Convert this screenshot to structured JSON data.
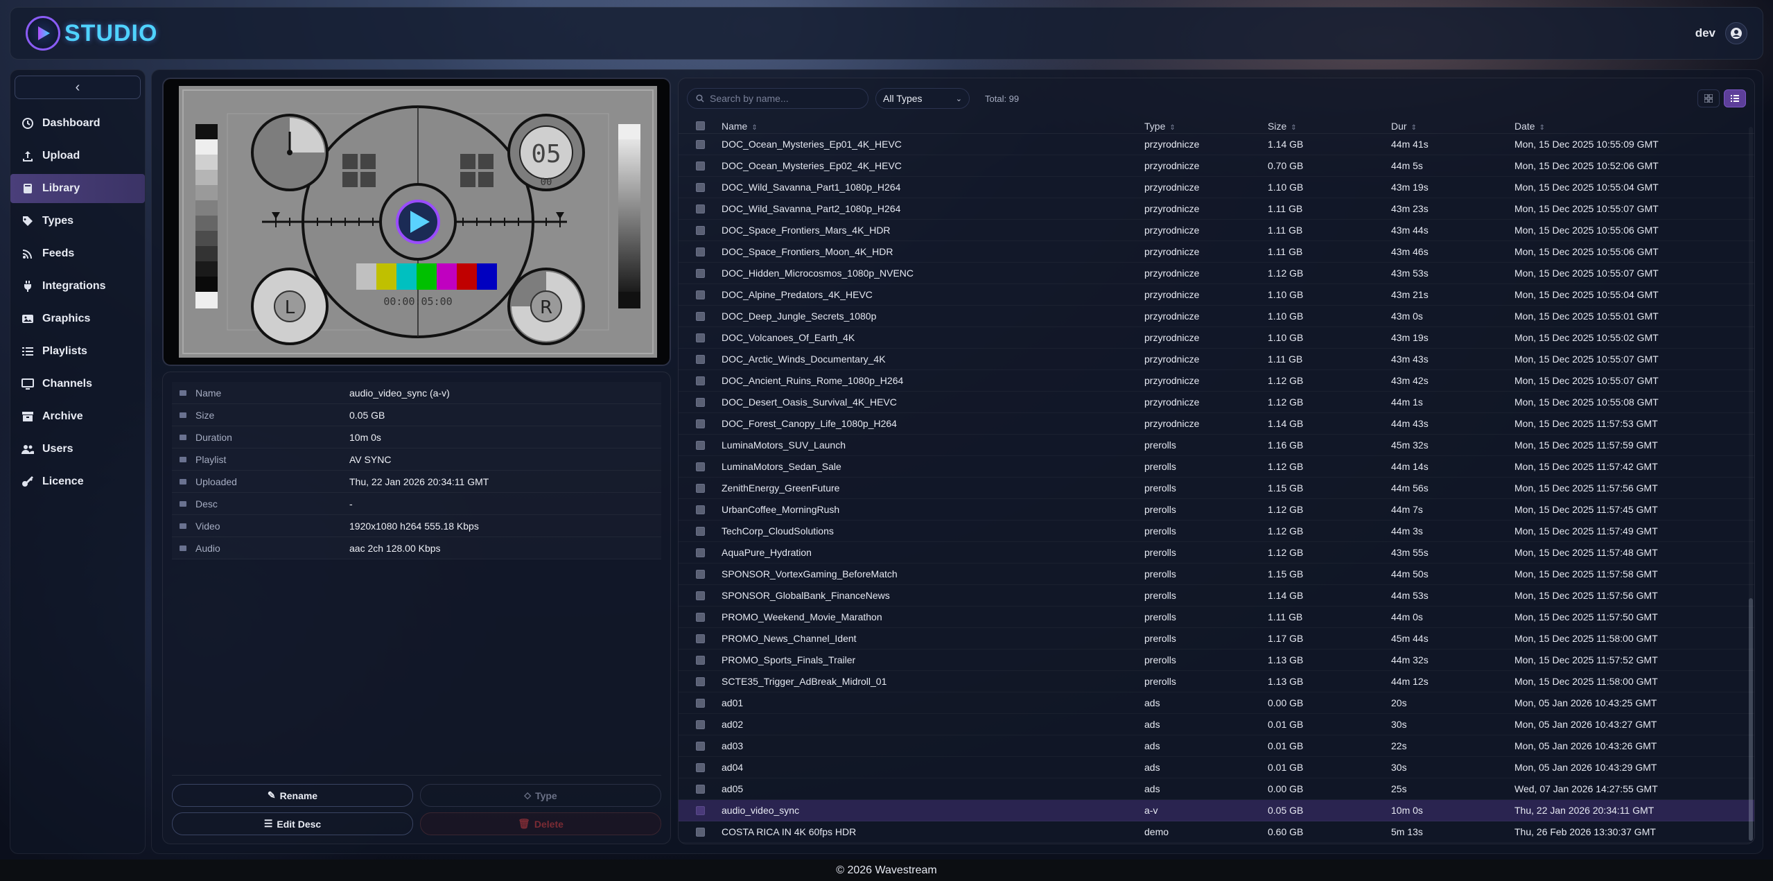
{
  "app": {
    "name": "STUDIO",
    "user": "dev",
    "footer": "© 2026 Wavestream",
    "accent": "#5d3f9a"
  },
  "sidebar": {
    "items": [
      {
        "label": "Dashboard",
        "icon": "dashboard-icon"
      },
      {
        "label": "Upload",
        "icon": "upload-icon"
      },
      {
        "label": "Library",
        "icon": "library-icon",
        "active": true
      },
      {
        "label": "Types",
        "icon": "tag-icon"
      },
      {
        "label": "Feeds",
        "icon": "feeds-icon"
      },
      {
        "label": "Integrations",
        "icon": "plug-icon"
      },
      {
        "label": "Graphics",
        "icon": "image-icon"
      },
      {
        "label": "Playlists",
        "icon": "list-icon"
      },
      {
        "label": "Channels",
        "icon": "monitor-icon"
      },
      {
        "label": "Archive",
        "icon": "archive-icon"
      },
      {
        "label": "Users",
        "icon": "users-icon"
      },
      {
        "label": "Licence",
        "icon": "key-icon"
      }
    ]
  },
  "preview": {
    "counter": "05",
    "sub": "00",
    "timecode": "00:00:05:00",
    "left": "L",
    "right": "R"
  },
  "details": {
    "rows": [
      {
        "label": "Name",
        "value": "audio_video_sync (a-v)"
      },
      {
        "label": "Size",
        "value": "0.05 GB"
      },
      {
        "label": "Duration",
        "value": "10m 0s"
      },
      {
        "label": "Playlist",
        "value": "AV SYNC"
      },
      {
        "label": "Uploaded",
        "value": "Thu, 22 Jan 2026 20:34:11 GMT"
      },
      {
        "label": "Desc",
        "value": "-"
      },
      {
        "label": "Video",
        "value": "1920x1080 h264 555.18 Kbps"
      },
      {
        "label": "Audio",
        "value": "aac 2ch 128.00 Kbps"
      }
    ],
    "actions": {
      "rename": "Rename",
      "type": "Type",
      "edit_desc": "Edit Desc",
      "delete": "Delete"
    }
  },
  "library": {
    "search_placeholder": "Search by name...",
    "type_filter": "All Types",
    "total": "Total: 99",
    "columns": {
      "name": "Name",
      "type": "Type",
      "size": "Size",
      "dur": "Dur",
      "date": "Date"
    },
    "rows": [
      [
        "DOC_Ocean_Mysteries_Ep01_4K_HEVC",
        "przyrodnicze",
        "1.14 GB",
        "44m 41s",
        "Mon, 15 Dec 2025 10:55:09 GMT"
      ],
      [
        "DOC_Ocean_Mysteries_Ep02_4K_HEVC",
        "przyrodnicze",
        "0.70 GB",
        "44m 5s",
        "Mon, 15 Dec 2025 10:52:06 GMT"
      ],
      [
        "DOC_Wild_Savanna_Part1_1080p_H264",
        "przyrodnicze",
        "1.10 GB",
        "43m 19s",
        "Mon, 15 Dec 2025 10:55:04 GMT"
      ],
      [
        "DOC_Wild_Savanna_Part2_1080p_H264",
        "przyrodnicze",
        "1.11 GB",
        "43m 23s",
        "Mon, 15 Dec 2025 10:55:07 GMT"
      ],
      [
        "DOC_Space_Frontiers_Mars_4K_HDR",
        "przyrodnicze",
        "1.11 GB",
        "43m 44s",
        "Mon, 15 Dec 2025 10:55:06 GMT"
      ],
      [
        "DOC_Space_Frontiers_Moon_4K_HDR",
        "przyrodnicze",
        "1.11 GB",
        "43m 46s",
        "Mon, 15 Dec 2025 10:55:06 GMT"
      ],
      [
        "DOC_Hidden_Microcosmos_1080p_NVENC",
        "przyrodnicze",
        "1.12 GB",
        "43m 53s",
        "Mon, 15 Dec 2025 10:55:07 GMT"
      ],
      [
        "DOC_Alpine_Predators_4K_HEVC",
        "przyrodnicze",
        "1.10 GB",
        "43m 21s",
        "Mon, 15 Dec 2025 10:55:04 GMT"
      ],
      [
        "DOC_Deep_Jungle_Secrets_1080p",
        "przyrodnicze",
        "1.10 GB",
        "43m 0s",
        "Mon, 15 Dec 2025 10:55:01 GMT"
      ],
      [
        "DOC_Volcanoes_Of_Earth_4K",
        "przyrodnicze",
        "1.10 GB",
        "43m 19s",
        "Mon, 15 Dec 2025 10:55:02 GMT"
      ],
      [
        "DOC_Arctic_Winds_Documentary_4K",
        "przyrodnicze",
        "1.11 GB",
        "43m 43s",
        "Mon, 15 Dec 2025 10:55:07 GMT"
      ],
      [
        "DOC_Ancient_Ruins_Rome_1080p_H264",
        "przyrodnicze",
        "1.12 GB",
        "43m 42s",
        "Mon, 15 Dec 2025 10:55:07 GMT"
      ],
      [
        "DOC_Desert_Oasis_Survival_4K_HEVC",
        "przyrodnicze",
        "1.12 GB",
        "44m 1s",
        "Mon, 15 Dec 2025 10:55:08 GMT"
      ],
      [
        "DOC_Forest_Canopy_Life_1080p_H264",
        "przyrodnicze",
        "1.14 GB",
        "44m 43s",
        "Mon, 15 Dec 2025 11:57:53 GMT"
      ],
      [
        "LuminaMotors_SUV_Launch",
        "prerolls",
        "1.16 GB",
        "45m 32s",
        "Mon, 15 Dec 2025 11:57:59 GMT"
      ],
      [
        "LuminaMotors_Sedan_Sale",
        "prerolls",
        "1.12 GB",
        "44m 14s",
        "Mon, 15 Dec 2025 11:57:42 GMT"
      ],
      [
        "ZenithEnergy_GreenFuture",
        "prerolls",
        "1.15 GB",
        "44m 56s",
        "Mon, 15 Dec 2025 11:57:56 GMT"
      ],
      [
        "UrbanCoffee_MorningRush",
        "prerolls",
        "1.12 GB",
        "44m 7s",
        "Mon, 15 Dec 2025 11:57:45 GMT"
      ],
      [
        "TechCorp_CloudSolutions",
        "prerolls",
        "1.12 GB",
        "44m 3s",
        "Mon, 15 Dec 2025 11:57:49 GMT"
      ],
      [
        "AquaPure_Hydration",
        "prerolls",
        "1.12 GB",
        "43m 55s",
        "Mon, 15 Dec 2025 11:57:48 GMT"
      ],
      [
        "SPONSOR_VortexGaming_BeforeMatch",
        "prerolls",
        "1.15 GB",
        "44m 50s",
        "Mon, 15 Dec 2025 11:57:58 GMT"
      ],
      [
        "SPONSOR_GlobalBank_FinanceNews",
        "prerolls",
        "1.14 GB",
        "44m 53s",
        "Mon, 15 Dec 2025 11:57:56 GMT"
      ],
      [
        "PROMO_Weekend_Movie_Marathon",
        "prerolls",
        "1.11 GB",
        "44m 0s",
        "Mon, 15 Dec 2025 11:57:50 GMT"
      ],
      [
        "PROMO_News_Channel_Ident",
        "prerolls",
        "1.17 GB",
        "45m 44s",
        "Mon, 15 Dec 2025 11:58:00 GMT"
      ],
      [
        "PROMO_Sports_Finals_Trailer",
        "prerolls",
        "1.13 GB",
        "44m 32s",
        "Mon, 15 Dec 2025 11:57:52 GMT"
      ],
      [
        "SCTE35_Trigger_AdBreak_Midroll_01",
        "prerolls",
        "1.13 GB",
        "44m 12s",
        "Mon, 15 Dec 2025 11:58:00 GMT"
      ],
      [
        "ad01",
        "ads",
        "0.00 GB",
        "20s",
        "Mon, 05 Jan 2026 10:43:25 GMT"
      ],
      [
        "ad02",
        "ads",
        "0.01 GB",
        "30s",
        "Mon, 05 Jan 2026 10:43:27 GMT"
      ],
      [
        "ad03",
        "ads",
        "0.01 GB",
        "22s",
        "Mon, 05 Jan 2026 10:43:26 GMT"
      ],
      [
        "ad04",
        "ads",
        "0.01 GB",
        "30s",
        "Mon, 05 Jan 2026 10:43:29 GMT"
      ],
      [
        "ad05",
        "ads",
        "0.00 GB",
        "25s",
        "Wed, 07 Jan 2026 14:27:55 GMT"
      ],
      [
        "audio_video_sync",
        "a-v",
        "0.05 GB",
        "10m 0s",
        "Thu, 22 Jan 2026 20:34:11 GMT"
      ],
      [
        "COSTA RICA IN 4K 60fps HDR",
        "demo",
        "0.60 GB",
        "5m 13s",
        "Thu, 26 Feb 2026 13:30:37 GMT"
      ]
    ],
    "selected_row": 31
  }
}
